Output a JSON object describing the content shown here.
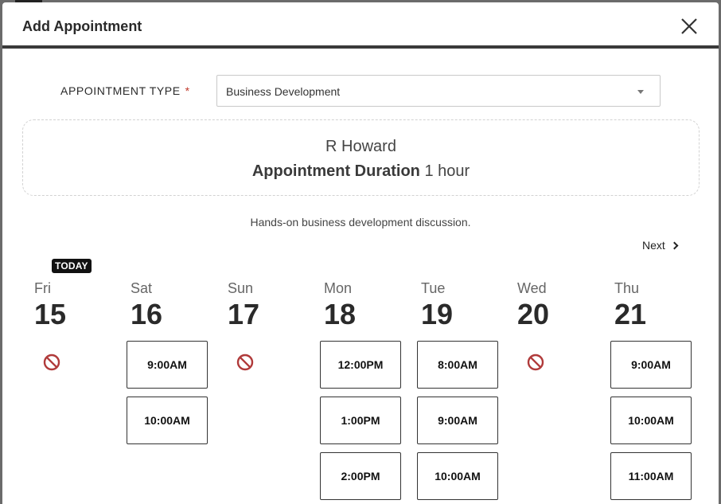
{
  "modal": {
    "title": "Add Appointment"
  },
  "appointment_type": {
    "label": "APPOINTMENT TYPE",
    "required_marker": "*",
    "selected": "Business Development"
  },
  "info": {
    "name": "R Howard",
    "duration_label": "Appointment Duration",
    "duration_value": "1 hour"
  },
  "description": "Hands-on business development discussion.",
  "nav": {
    "next_label": "Next"
  },
  "today_badge": "TODAY",
  "days": [
    {
      "name": "Fri",
      "num": "15",
      "slots": []
    },
    {
      "name": "Sat",
      "num": "16",
      "slots": [
        "9:00AM",
        "10:00AM"
      ]
    },
    {
      "name": "Sun",
      "num": "17",
      "slots": []
    },
    {
      "name": "Mon",
      "num": "18",
      "slots": [
        "12:00PM",
        "1:00PM",
        "2:00PM"
      ]
    },
    {
      "name": "Tue",
      "num": "19",
      "slots": [
        "8:00AM",
        "9:00AM",
        "10:00AM"
      ]
    },
    {
      "name": "Wed",
      "num": "20",
      "slots": []
    },
    {
      "name": "Thu",
      "num": "21",
      "slots": [
        "9:00AM",
        "10:00AM",
        "11:00AM"
      ]
    }
  ],
  "colors": {
    "unavailable": "#b03a3a",
    "header_border": "#3a3a3a"
  },
  "icons": {
    "close": "close-icon",
    "dropdown": "chevron-down-icon",
    "next": "chevron-right-icon",
    "unavailable": "no-entry-icon"
  }
}
